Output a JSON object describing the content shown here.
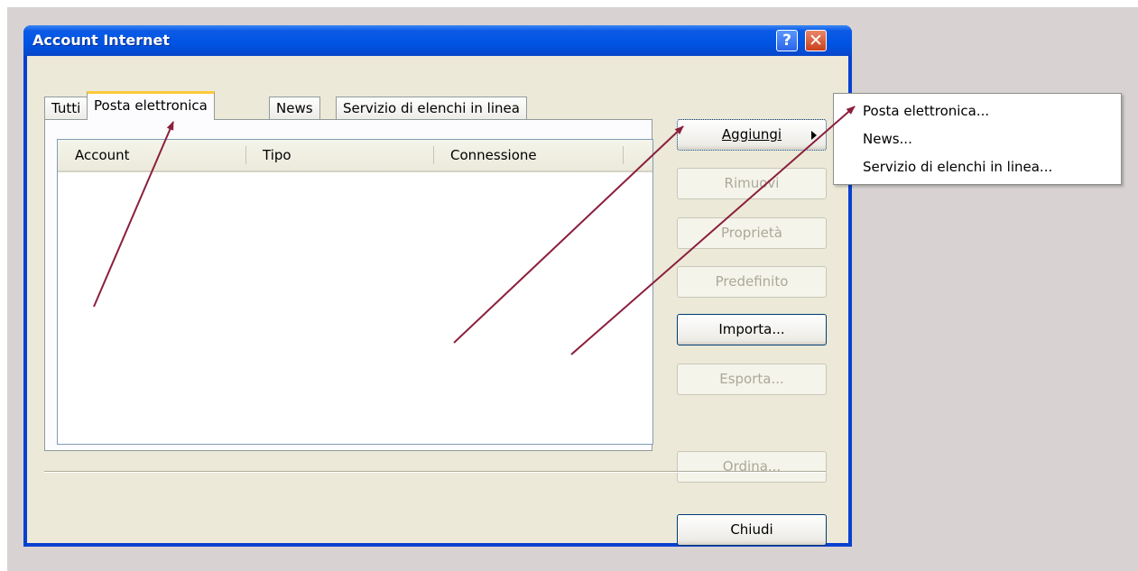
{
  "window": {
    "title": "Account Internet",
    "help_label": "?",
    "close_label": "✕"
  },
  "tabs": [
    {
      "label": "Tutti"
    },
    {
      "label": "Posta elettronica"
    },
    {
      "label": "News"
    },
    {
      "label": "Servizio di elenchi in linea"
    }
  ],
  "active_tab": "Posta elettronica",
  "list": {
    "columns": [
      "Account",
      "Tipo",
      "Connessione"
    ],
    "rows": []
  },
  "buttons": {
    "add": "Aggiungi",
    "remove": "Rimuovi",
    "properties": "Proprietà",
    "default": "Predefinito",
    "import": "Importa...",
    "export": "Esporta...",
    "order": "Ordina...",
    "close": "Chiudi"
  },
  "add_menu": {
    "items": [
      "Posta elettronica...",
      "News...",
      "Servizio di elenchi in linea..."
    ]
  },
  "colors": {
    "titlebar": "#0054e3",
    "annotation_arrow": "#8b1f3c"
  }
}
